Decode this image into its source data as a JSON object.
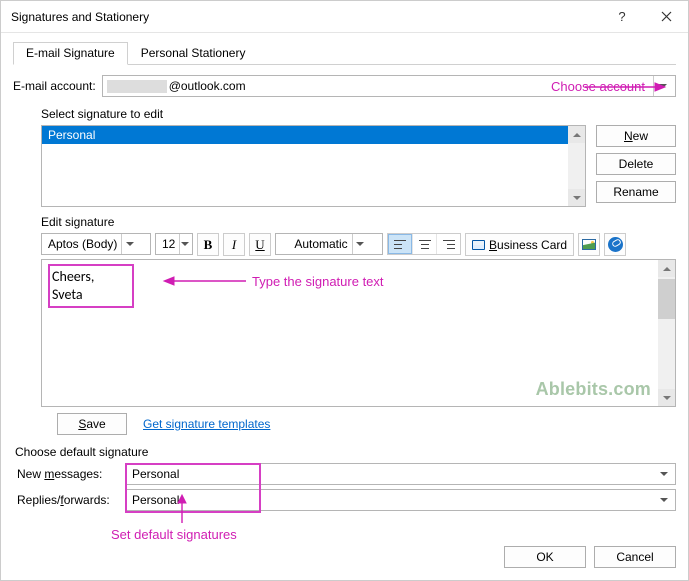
{
  "window_title": "Signatures and Stationery",
  "tabs": {
    "email_signature": "E-mail Signature",
    "personal_stationery": "Personal Stationery"
  },
  "account": {
    "label": "E-mail account:",
    "value": "@outlook.com"
  },
  "select_label": "Select signature to edit",
  "signatures": [
    "Personal"
  ],
  "buttons": {
    "new": "New",
    "delete": "Delete",
    "rename": "Rename",
    "save": "Save",
    "ok": "OK",
    "cancel": "Cancel",
    "business_card": "Business Card"
  },
  "edit_label": "Edit signature",
  "toolbar": {
    "font": "Aptos (Body)",
    "size": "12",
    "color": "Automatic"
  },
  "signature_text": {
    "line1": "Cheers,",
    "line2": "Sveta"
  },
  "watermark": "Ablebits.com",
  "templates_link": "Get signature templates",
  "default_section_label": "Choose default signature",
  "defaults": {
    "new_label": "New messages:",
    "reply_label": "Replies/forwards:",
    "new_value": "Personal",
    "reply_value": "Personal"
  },
  "annotations": {
    "choose_account": "Choose account",
    "type_sig": "Type the signature text",
    "set_defaults": "Set default signatures"
  }
}
